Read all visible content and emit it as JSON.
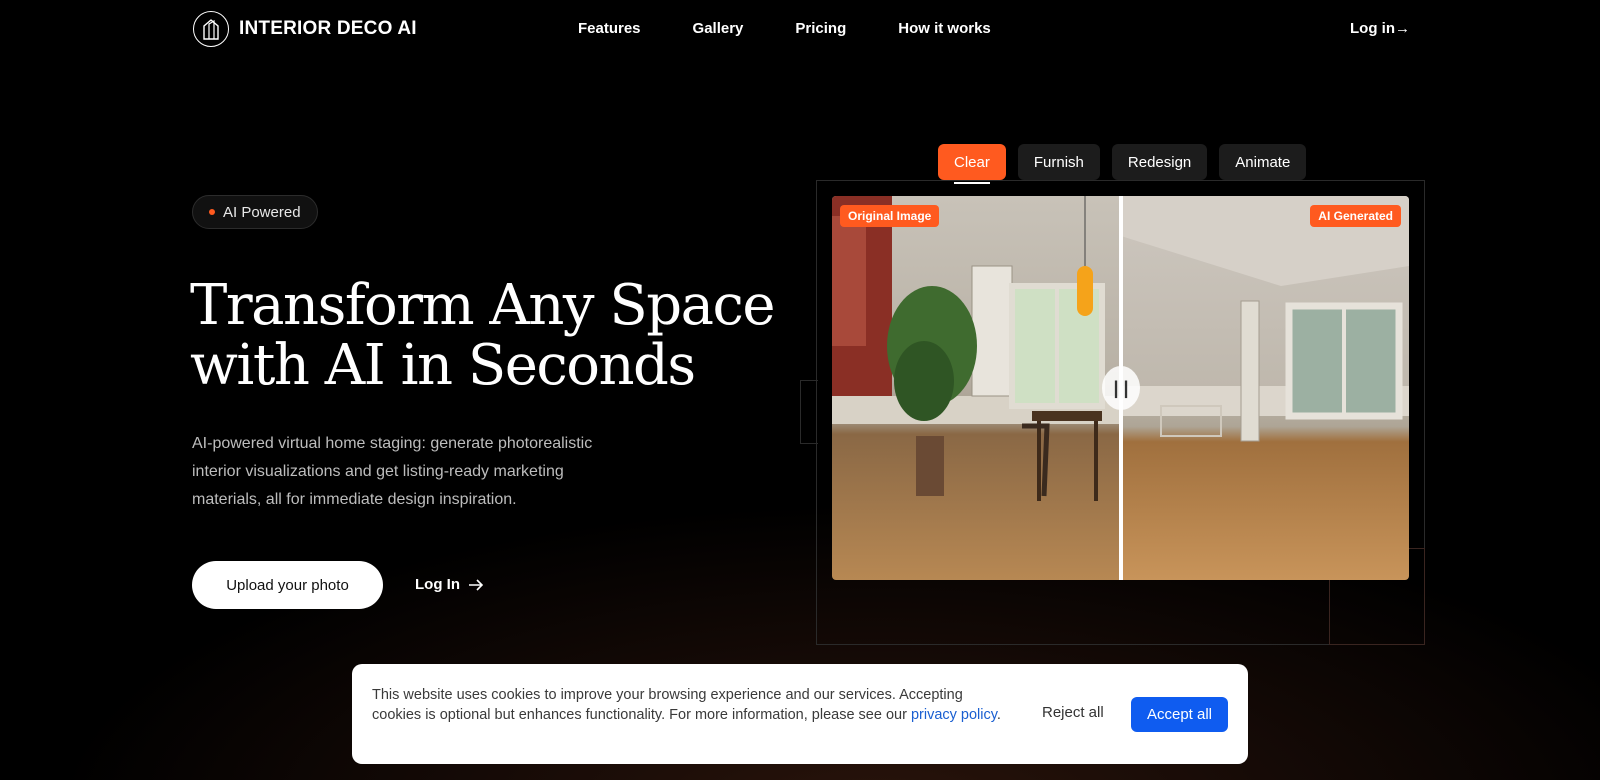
{
  "nav": {
    "brand": "INTERIOR DECO AI",
    "links": [
      "Features",
      "Gallery",
      "Pricing",
      "How it works"
    ],
    "login": "Log in→"
  },
  "hero": {
    "badge": "AI Powered",
    "title_line1": "Transform Any Space",
    "title_line2": "with AI in Seconds",
    "description": "AI-powered virtual home staging: generate photorealistic interior visualizations and get listing-ready marketing materials, all for immediate design inspiration.",
    "upload_button": "Upload your photo",
    "login_link": "Log In"
  },
  "tabs": [
    {
      "label": "Clear",
      "active": true
    },
    {
      "label": "Furnish",
      "active": false
    },
    {
      "label": "Redesign",
      "active": false
    },
    {
      "label": "Animate",
      "active": false
    }
  ],
  "compare": {
    "left_label": "Original Image",
    "right_label": "AI Generated",
    "handle_glyph": "| |"
  },
  "cookie": {
    "text": "This website uses cookies to improve your browsing experience and our services. Accepting cookies is optional but enhances functionality. For more information, please see our ",
    "link": "privacy policy",
    "after_link": ".",
    "reject": "Reject all",
    "accept": "Accept all"
  },
  "colors": {
    "accent": "#ff5a1f",
    "accept_blue": "#0f5cf0",
    "link_blue": "#1a5fd1"
  }
}
